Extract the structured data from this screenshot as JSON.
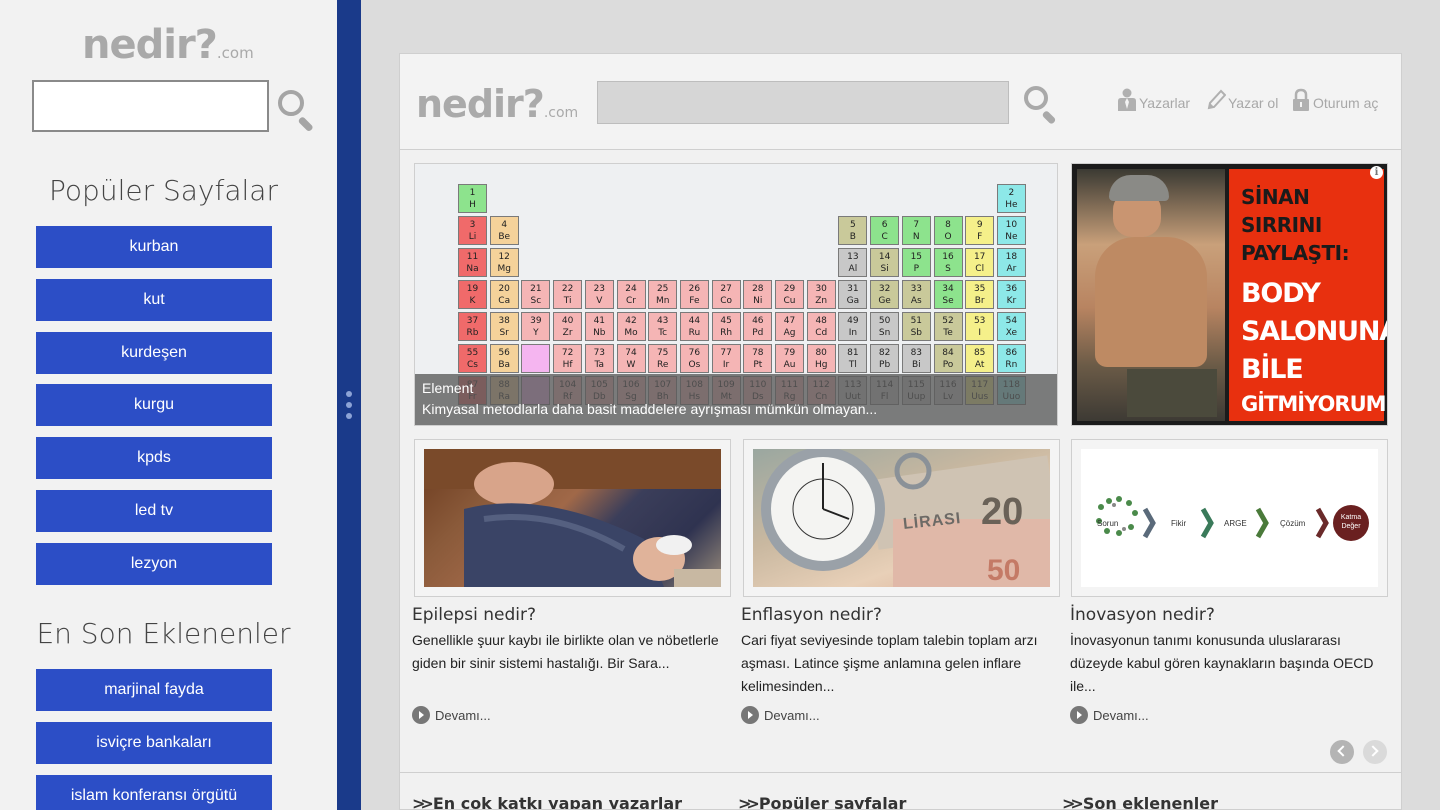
{
  "app": {
    "logo_main": "nedir?",
    "logo_suffix": ".com"
  },
  "sidebar": {
    "search_value": "",
    "popular_heading": "Popüler Sayfalar",
    "popular_items": [
      "kurban",
      "kut",
      "kurdeşen",
      "kurgu",
      "kpds",
      "led tv",
      "lezyon"
    ],
    "recent_heading": "En Son Eklenenler",
    "recent_items": [
      "marjinal fayda",
      "isviçre bankaları",
      "islam konferansı örgütü"
    ]
  },
  "topbar": {
    "search_value": "",
    "links": [
      {
        "label": "Yazarlar",
        "icon": "authors-icon"
      },
      {
        "label": "Yazar ol",
        "icon": "pencil-icon"
      },
      {
        "label": "Oturum aç",
        "icon": "lock-icon"
      }
    ]
  },
  "feature": {
    "title": "Element",
    "summary": "Kimyasal metodlarla daha basit maddelere ayrışması mümkün olmayan..."
  },
  "periodic_table": [
    {
      "n": "1",
      "s": "H",
      "c": "#8de38d",
      "col": 0,
      "row": 0
    },
    {
      "n": "2",
      "s": "He",
      "c": "#8de8e8",
      "col": 17,
      "row": 0
    },
    {
      "n": "3",
      "s": "Li",
      "c": "#f06a6a",
      "col": 0,
      "row": 1
    },
    {
      "n": "4",
      "s": "Be",
      "c": "#f5d29a",
      "col": 1,
      "row": 1
    },
    {
      "n": "5",
      "s": "B",
      "c": "#c9c99a",
      "col": 12,
      "row": 1
    },
    {
      "n": "6",
      "s": "C",
      "c": "#8de38d",
      "col": 13,
      "row": 1
    },
    {
      "n": "7",
      "s": "N",
      "c": "#8de38d",
      "col": 14,
      "row": 1
    },
    {
      "n": "8",
      "s": "O",
      "c": "#8de38d",
      "col": 15,
      "row": 1
    },
    {
      "n": "9",
      "s": "F",
      "c": "#f5f08a",
      "col": 16,
      "row": 1
    },
    {
      "n": "10",
      "s": "Ne",
      "c": "#8de8e8",
      "col": 17,
      "row": 1
    },
    {
      "n": "11",
      "s": "Na",
      "c": "#f06a6a",
      "col": 0,
      "row": 2
    },
    {
      "n": "12",
      "s": "Mg",
      "c": "#f5d29a",
      "col": 1,
      "row": 2
    },
    {
      "n": "13",
      "s": "Al",
      "c": "#c8c8c8",
      "col": 12,
      "row": 2
    },
    {
      "n": "14",
      "s": "Si",
      "c": "#c9c99a",
      "col": 13,
      "row": 2
    },
    {
      "n": "15",
      "s": "P",
      "c": "#8de38d",
      "col": 14,
      "row": 2
    },
    {
      "n": "16",
      "s": "S",
      "c": "#8de38d",
      "col": 15,
      "row": 2
    },
    {
      "n": "17",
      "s": "Cl",
      "c": "#f5f08a",
      "col": 16,
      "row": 2
    },
    {
      "n": "18",
      "s": "Ar",
      "c": "#8de8e8",
      "col": 17,
      "row": 2
    },
    {
      "n": "19",
      "s": "K",
      "c": "#f06a6a",
      "col": 0,
      "row": 3
    },
    {
      "n": "20",
      "s": "Ca",
      "c": "#f5d29a",
      "col": 1,
      "row": 3
    },
    {
      "n": "21",
      "s": "Sc",
      "c": "#f5b5b5",
      "col": 2,
      "row": 3
    },
    {
      "n": "22",
      "s": "Ti",
      "c": "#f5b5b5",
      "col": 3,
      "row": 3
    },
    {
      "n": "23",
      "s": "V",
      "c": "#f5b5b5",
      "col": 4,
      "row": 3
    },
    {
      "n": "24",
      "s": "Cr",
      "c": "#f5b5b5",
      "col": 5,
      "row": 3
    },
    {
      "n": "25",
      "s": "Mn",
      "c": "#f5b5b5",
      "col": 6,
      "row": 3
    },
    {
      "n": "26",
      "s": "Fe",
      "c": "#f5b5b5",
      "col": 7,
      "row": 3
    },
    {
      "n": "27",
      "s": "Co",
      "c": "#f5b5b5",
      "col": 8,
      "row": 3
    },
    {
      "n": "28",
      "s": "Ni",
      "c": "#f5b5b5",
      "col": 9,
      "row": 3
    },
    {
      "n": "29",
      "s": "Cu",
      "c": "#f5b5b5",
      "col": 10,
      "row": 3
    },
    {
      "n": "30",
      "s": "Zn",
      "c": "#f5b5b5",
      "col": 11,
      "row": 3
    },
    {
      "n": "31",
      "s": "Ga",
      "c": "#c8c8c8",
      "col": 12,
      "row": 3
    },
    {
      "n": "32",
      "s": "Ge",
      "c": "#c9c99a",
      "col": 13,
      "row": 3
    },
    {
      "n": "33",
      "s": "As",
      "c": "#c9c99a",
      "col": 14,
      "row": 3
    },
    {
      "n": "34",
      "s": "Se",
      "c": "#8de38d",
      "col": 15,
      "row": 3
    },
    {
      "n": "35",
      "s": "Br",
      "c": "#f5f08a",
      "col": 16,
      "row": 3
    },
    {
      "n": "36",
      "s": "Kr",
      "c": "#8de8e8",
      "col": 17,
      "row": 3
    },
    {
      "n": "37",
      "s": "Rb",
      "c": "#f06a6a",
      "col": 0,
      "row": 4
    },
    {
      "n": "38",
      "s": "Sr",
      "c": "#f5d29a",
      "col": 1,
      "row": 4
    },
    {
      "n": "39",
      "s": "Y",
      "c": "#f5b5b5",
      "col": 2,
      "row": 4
    },
    {
      "n": "40",
      "s": "Zr",
      "c": "#f5b5b5",
      "col": 3,
      "row": 4
    },
    {
      "n": "41",
      "s": "Nb",
      "c": "#f5b5b5",
      "col": 4,
      "row": 4
    },
    {
      "n": "42",
      "s": "Mo",
      "c": "#f5b5b5",
      "col": 5,
      "row": 4
    },
    {
      "n": "43",
      "s": "Tc",
      "c": "#f5b5b5",
      "col": 6,
      "row": 4
    },
    {
      "n": "44",
      "s": "Ru",
      "c": "#f5b5b5",
      "col": 7,
      "row": 4
    },
    {
      "n": "45",
      "s": "Rh",
      "c": "#f5b5b5",
      "col": 8,
      "row": 4
    },
    {
      "n": "46",
      "s": "Pd",
      "c": "#f5b5b5",
      "col": 9,
      "row": 4
    },
    {
      "n": "47",
      "s": "Ag",
      "c": "#f5b5b5",
      "col": 10,
      "row": 4
    },
    {
      "n": "48",
      "s": "Cd",
      "c": "#f5b5b5",
      "col": 11,
      "row": 4
    },
    {
      "n": "49",
      "s": "In",
      "c": "#c8c8c8",
      "col": 12,
      "row": 4
    },
    {
      "n": "50",
      "s": "Sn",
      "c": "#c8c8c8",
      "col": 13,
      "row": 4
    },
    {
      "n": "51",
      "s": "Sb",
      "c": "#c9c99a",
      "col": 14,
      "row": 4
    },
    {
      "n": "52",
      "s": "Te",
      "c": "#c9c99a",
      "col": 15,
      "row": 4
    },
    {
      "n": "53",
      "s": "I",
      "c": "#f5f08a",
      "col": 16,
      "row": 4
    },
    {
      "n": "54",
      "s": "Xe",
      "c": "#8de8e8",
      "col": 17,
      "row": 4
    },
    {
      "n": "55",
      "s": "Cs",
      "c": "#f06a6a",
      "col": 0,
      "row": 5
    },
    {
      "n": "56",
      "s": "Ba",
      "c": "#f5d29a",
      "col": 1,
      "row": 5
    },
    {
      "n": "",
      "s": "",
      "c": "#f5b5f0",
      "col": 2,
      "row": 5
    },
    {
      "n": "72",
      "s": "Hf",
      "c": "#f5b5b5",
      "col": 3,
      "row": 5
    },
    {
      "n": "73",
      "s": "Ta",
      "c": "#f5b5b5",
      "col": 4,
      "row": 5
    },
    {
      "n": "74",
      "s": "W",
      "c": "#f5b5b5",
      "col": 5,
      "row": 5
    },
    {
      "n": "75",
      "s": "Re",
      "c": "#f5b5b5",
      "col": 6,
      "row": 5
    },
    {
      "n": "76",
      "s": "Os",
      "c": "#f5b5b5",
      "col": 7,
      "row": 5
    },
    {
      "n": "77",
      "s": "Ir",
      "c": "#f5b5b5",
      "col": 8,
      "row": 5
    },
    {
      "n": "78",
      "s": "Pt",
      "c": "#f5b5b5",
      "col": 9,
      "row": 5
    },
    {
      "n": "79",
      "s": "Au",
      "c": "#f5b5b5",
      "col": 10,
      "row": 5
    },
    {
      "n": "80",
      "s": "Hg",
      "c": "#f5b5b5",
      "col": 11,
      "row": 5
    },
    {
      "n": "81",
      "s": "Tl",
      "c": "#c8c8c8",
      "col": 12,
      "row": 5
    },
    {
      "n": "82",
      "s": "Pb",
      "c": "#c8c8c8",
      "col": 13,
      "row": 5
    },
    {
      "n": "83",
      "s": "Bi",
      "c": "#c8c8c8",
      "col": 14,
      "row": 5
    },
    {
      "n": "84",
      "s": "Po",
      "c": "#c9c99a",
      "col": 15,
      "row": 5
    },
    {
      "n": "85",
      "s": "At",
      "c": "#f5f08a",
      "col": 16,
      "row": 5
    },
    {
      "n": "86",
      "s": "Rn",
      "c": "#8de8e8",
      "col": 17,
      "row": 5
    },
    {
      "n": "87",
      "s": "Fr",
      "c": "#f06a6a",
      "col": 0,
      "row": 6
    },
    {
      "n": "88",
      "s": "Ra",
      "c": "#f5d29a",
      "col": 1,
      "row": 6
    },
    {
      "n": "",
      "s": "",
      "c": "#f5b5f0",
      "col": 2,
      "row": 6
    },
    {
      "n": "104",
      "s": "Rf",
      "c": "#f5b5b5",
      "col": 3,
      "row": 6
    },
    {
      "n": "105",
      "s": "Db",
      "c": "#f5b5b5",
      "col": 4,
      "row": 6
    },
    {
      "n": "106",
      "s": "Sg",
      "c": "#f5b5b5",
      "col": 5,
      "row": 6
    },
    {
      "n": "107",
      "s": "Bh",
      "c": "#f5b5b5",
      "col": 6,
      "row": 6
    },
    {
      "n": "108",
      "s": "Hs",
      "c": "#f5b5b5",
      "col": 7,
      "row": 6
    },
    {
      "n": "109",
      "s": "Mt",
      "c": "#f5b5b5",
      "col": 8,
      "row": 6
    },
    {
      "n": "110",
      "s": "Ds",
      "c": "#f5b5b5",
      "col": 9,
      "row": 6
    },
    {
      "n": "111",
      "s": "Rg",
      "c": "#f5b5b5",
      "col": 10,
      "row": 6
    },
    {
      "n": "112",
      "s": "Cn",
      "c": "#f5b5b5",
      "col": 11,
      "row": 6
    },
    {
      "n": "113",
      "s": "Uut",
      "c": "#c8c8c8",
      "col": 12,
      "row": 6
    },
    {
      "n": "114",
      "s": "Fl",
      "c": "#c8c8c8",
      "col": 13,
      "row": 6
    },
    {
      "n": "115",
      "s": "Uup",
      "c": "#c8c8c8",
      "col": 14,
      "row": 6
    },
    {
      "n": "116",
      "s": "Lv",
      "c": "#c8c8c8",
      "col": 15,
      "row": 6
    },
    {
      "n": "117",
      "s": "Uus",
      "c": "#f5f08a",
      "col": 16,
      "row": 6
    },
    {
      "n": "118",
      "s": "Uuo",
      "c": "#8de8e8",
      "col": 17,
      "row": 6
    }
  ],
  "ad": {
    "line1a": "SİNAN",
    "line1b": "SIRRINI",
    "line1c": "PAYLAŞTI:",
    "line2a": "BODY",
    "line2b": "SALONUNA",
    "line2c": "BİLE",
    "line3": "GİTMİYORUM!",
    "info_glyph": "i"
  },
  "cards": [
    {
      "title": "Epilepsi nedir?",
      "text": "Genellikle şuur kaybı ile birlikte olan ve nöbetlerle giden bir sinir sistemi hastalığı. Bir Sara...",
      "more": "Devamı..."
    },
    {
      "title": "Enflasyon nedir?",
      "text": "Cari fiyat seviyesinde toplam talebin toplam arzı aşması. Latince şişme anlamına gelen inflare kelimesinden...",
      "more": "Devamı..."
    },
    {
      "title": "İnovasyon nedir?",
      "text": "İnovasyonun tanımı konusunda uluslararası düzeyde kabul gören kaynakların başında OECD ile...",
      "more": "Devamı..."
    }
  ],
  "money_img": {
    "label_lira": "LİRASI",
    "label_20": "20",
    "label_50": "50"
  },
  "innovation_diagram": [
    "Sorun",
    "Fikir",
    "ARGE",
    "Çözüm",
    "Katma Değer"
  ],
  "bottom": {
    "headings": [
      "En çok katkı yapan yazarlar",
      "Popüler sayfalar",
      "Son eklenenler"
    ]
  },
  "colors": {
    "accent_blue": "#2c4ec6",
    "splitter": "#1a3a8a",
    "ad_red": "#e8300f"
  }
}
